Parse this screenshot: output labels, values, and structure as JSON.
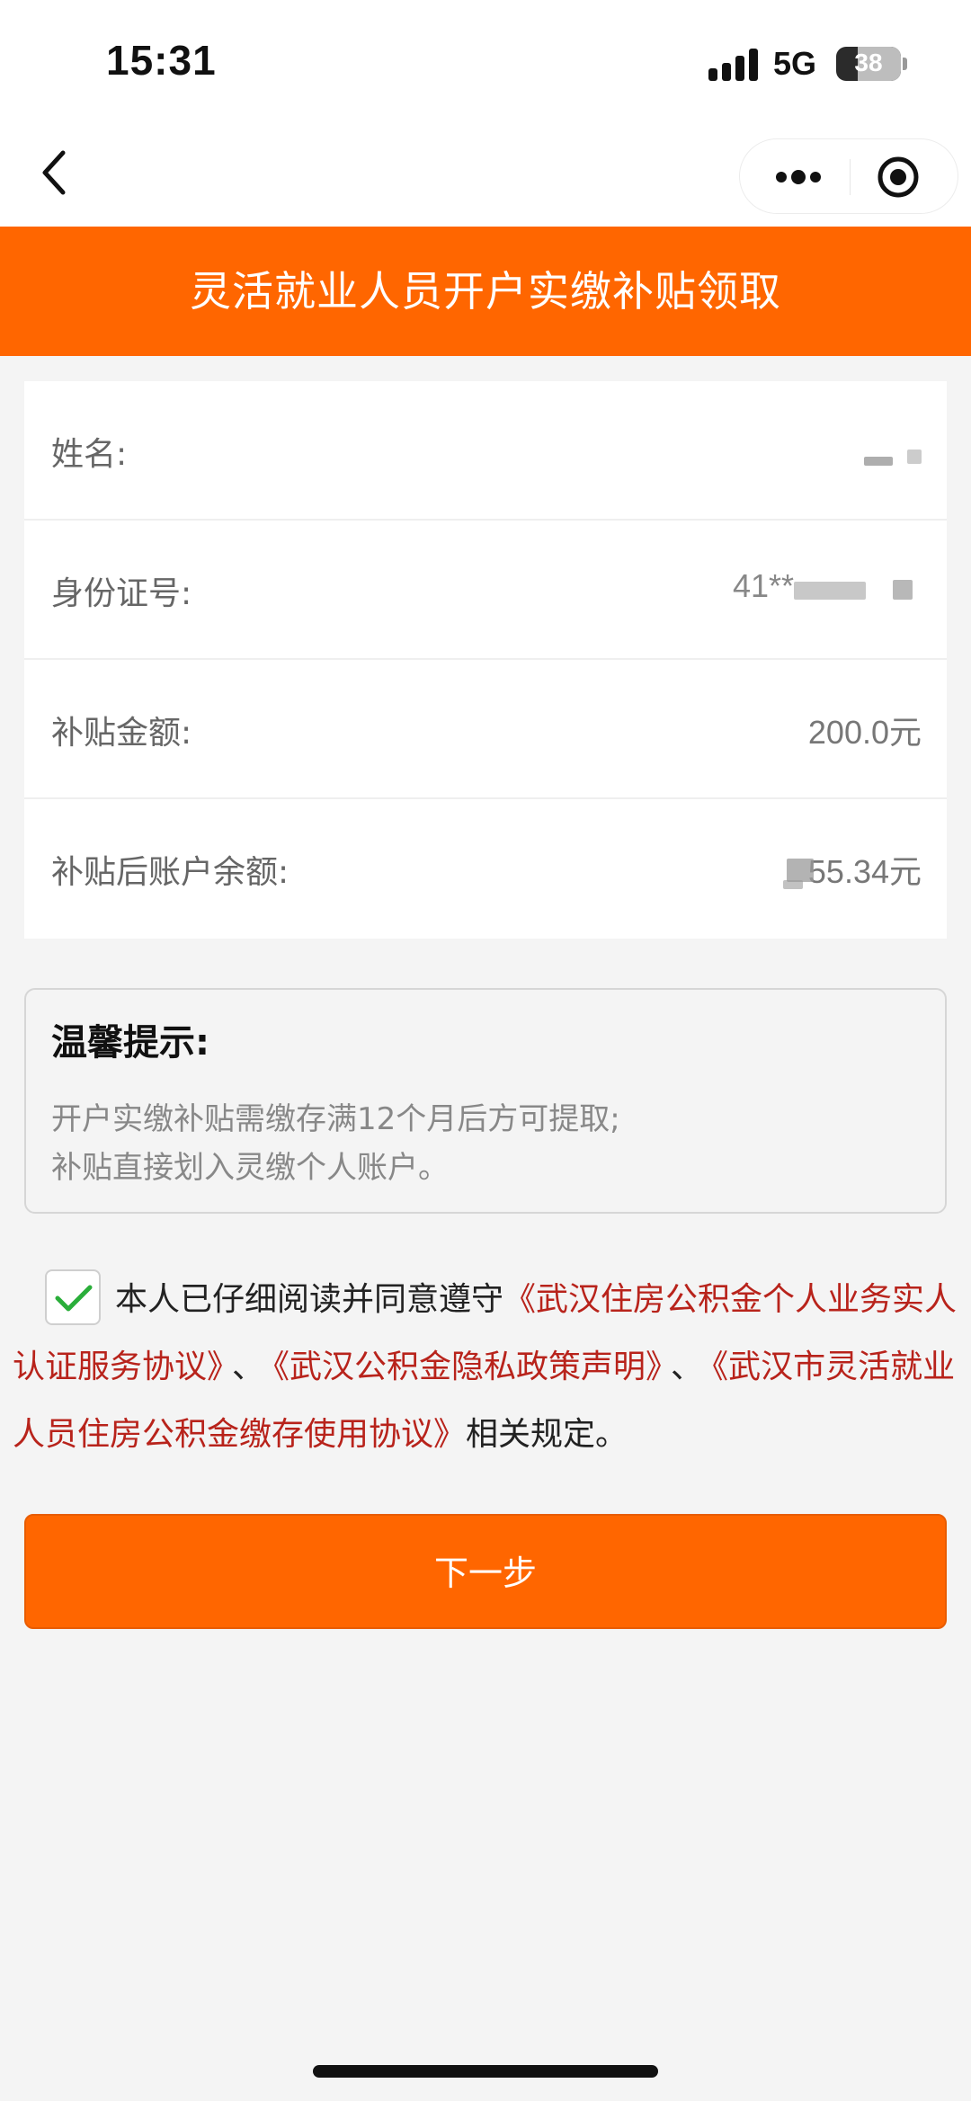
{
  "status_bar": {
    "time": "15:31",
    "network": "5G",
    "battery": "38"
  },
  "nav": {
    "back_icon": "chevron-left-icon",
    "more_icon": "more-dots-icon",
    "close_icon": "target-circle-icon"
  },
  "header": {
    "title": "灵活就业人员开户实缴补贴领取"
  },
  "info": {
    "name_label": "姓名:",
    "id_label": "身份证号:",
    "id_value_partial": "41**",
    "subsidy_label": "补贴金额:",
    "subsidy_value": "200.0元",
    "balance_label": "补贴后账户余额:",
    "balance_value_partial": "55.34元"
  },
  "tips": {
    "title": "温馨提示:",
    "line1": "开户实缴补贴需缴存满12个月后方可提取;",
    "line2": "补贴直接划入灵缴个人账户。"
  },
  "agreement": {
    "checked": true,
    "prefix": "本人已仔细阅读并同意遵守",
    "link1": "《武汉住房公积金个人业务实人认证服务协议》",
    "sep1": "、",
    "link2": "《武汉公积金隐私政策声明》",
    "sep2": "、",
    "link3": "《武汉市灵活就业人员住房公积金缴存使用协议》",
    "suffix": "相关规定。"
  },
  "actions": {
    "next_label": "下一步"
  },
  "colors": {
    "brand_orange": "#ff6600",
    "link_red": "#b8231b",
    "check_green": "#2aae3a"
  }
}
